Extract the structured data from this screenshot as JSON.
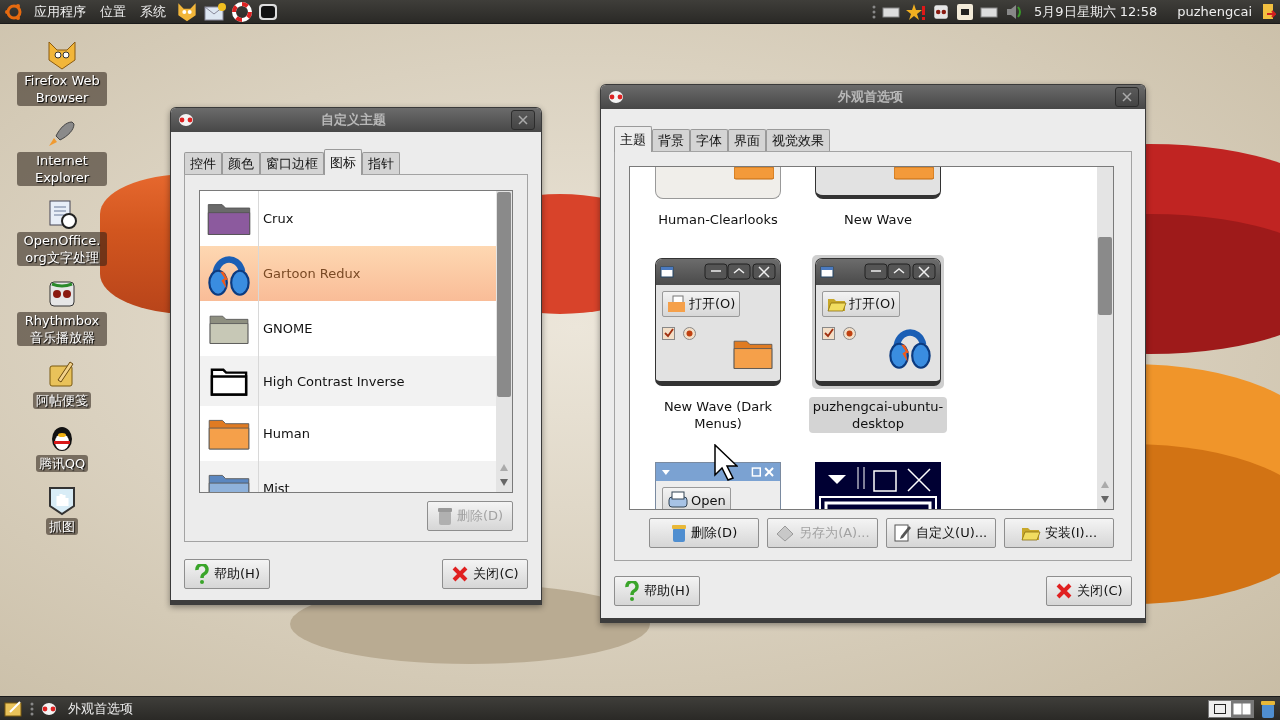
{
  "top_panel": {
    "menus": [
      "应用程序",
      "位置",
      "系统"
    ],
    "clock": "5月9日星期六 12:58",
    "user": "puzhengcai"
  },
  "desktop_icons": [
    {
      "label": "Firefox Web Browser"
    },
    {
      "label": "Internet Explorer"
    },
    {
      "label": "OpenOffice.org文字处理"
    },
    {
      "label": "Rhythmbox 音乐播放器"
    },
    {
      "label": "阿帖便笺"
    },
    {
      "label": "腾讯QQ"
    },
    {
      "label": "抓图"
    }
  ],
  "theme_dialog": {
    "title": "自定义主题",
    "tabs": [
      {
        "label": "控件",
        "selected": false
      },
      {
        "label": "颜色",
        "selected": false
      },
      {
        "label": "窗口边框",
        "selected": false
      },
      {
        "label": "图标",
        "selected": true
      },
      {
        "label": "指针",
        "selected": false
      }
    ],
    "themes": [
      {
        "name": "Crux",
        "kind": "crux",
        "selected": false
      },
      {
        "name": "Gartoon Redux",
        "kind": "gartoon",
        "selected": true
      },
      {
        "name": "GNOME",
        "kind": "gnome",
        "selected": false
      },
      {
        "name": "High Contrast Inverse",
        "kind": "contrast",
        "selected": false
      },
      {
        "name": "Human",
        "kind": "human",
        "selected": false
      },
      {
        "name": "Mist",
        "kind": "mist",
        "selected": false
      }
    ],
    "delete_button": {
      "label": "删除(D)",
      "disabled": true
    },
    "buttons": [
      {
        "label": "帮助(H)",
        "kind": "help"
      },
      {
        "label": "关闭(C)",
        "kind": "close"
      }
    ]
  },
  "appearance_dialog": {
    "title": "外观首选项",
    "tabs": [
      {
        "label": "主题",
        "selected": true
      },
      {
        "label": "背景",
        "selected": false
      },
      {
        "label": "字体",
        "selected": false
      },
      {
        "label": "界面",
        "selected": false
      },
      {
        "label": "视觉效果",
        "selected": false
      }
    ],
    "themes": [
      {
        "name": "Human-Clearlooks",
        "kind": "human",
        "selected": false
      },
      {
        "name": "New Wave",
        "kind": "newwave",
        "selected": false
      },
      {
        "name": "New Wave (Dark Menus)",
        "kind": "newwave-dark",
        "selected": false,
        "button_label": "打开(O)"
      },
      {
        "name": "puzhengcai-ubuntu-desktop",
        "kind": "custom",
        "selected": true,
        "button_label": "打开(O)"
      },
      {
        "kind": "clearlooks-blue",
        "selected": false,
        "button_label": "Open"
      },
      {
        "kind": "high-contrast",
        "selected": false
      }
    ],
    "actions": [
      {
        "label": "删除(D)",
        "kind": "delete",
        "disabled": false
      },
      {
        "label": "另存为(A)...",
        "kind": "save",
        "disabled": true
      },
      {
        "label": "自定义(U)...",
        "kind": "customize",
        "disabled": false
      },
      {
        "label": "安装(I)...",
        "kind": "install",
        "disabled": false
      }
    ],
    "buttons": [
      {
        "label": "帮助(H)",
        "kind": "help"
      },
      {
        "label": "关闭(C)",
        "kind": "close"
      }
    ]
  },
  "bottom_panel": {
    "task": "外观首选项"
  }
}
